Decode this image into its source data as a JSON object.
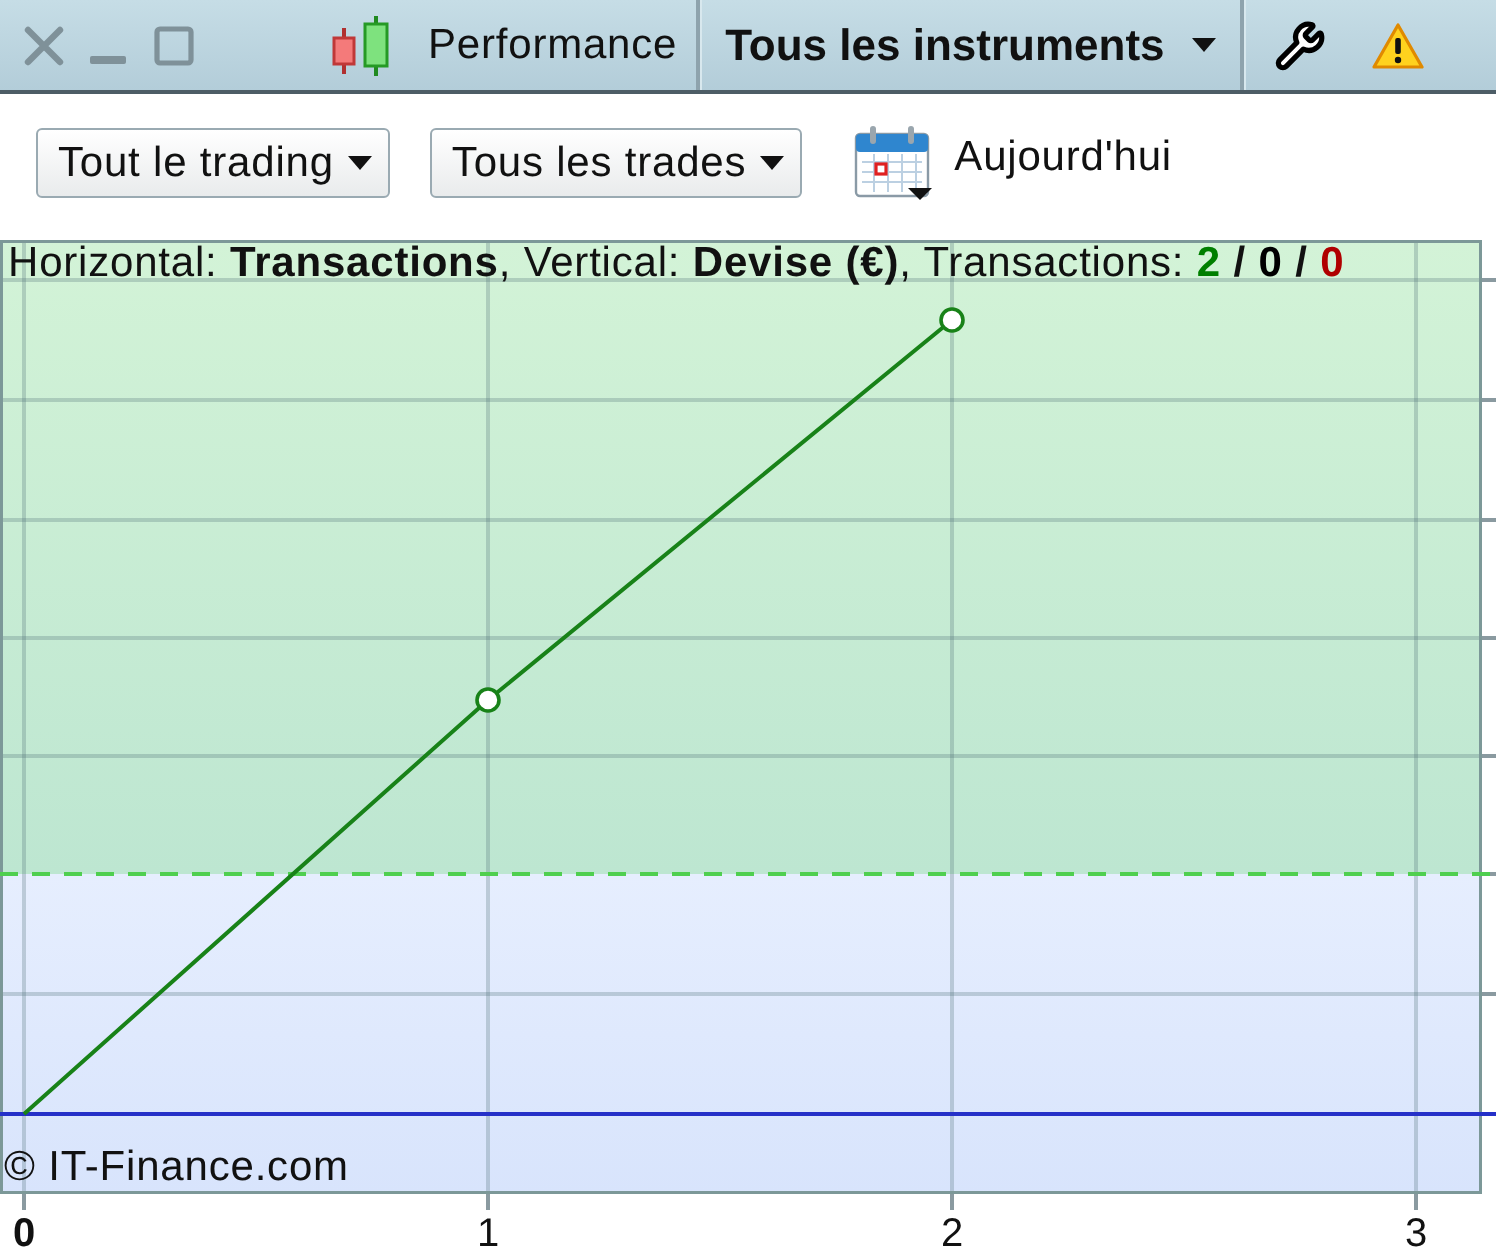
{
  "title_bar": {
    "title": "Performance",
    "instrument_menu": "Tous les instruments"
  },
  "toolbar": {
    "filters": [
      {
        "label": "Tout le trading"
      },
      {
        "label": "Tous les trades"
      }
    ],
    "date_label": "Aujourd'hui"
  },
  "chart": {
    "caption": {
      "text": "Horizontal: **Transactions**, Vertical: **Devise (€)**, Transactions:",
      "counts": [
        {
          "value": "2",
          "color": "#007f00"
        },
        {
          "value": "0",
          "color": "#000000"
        },
        {
          "value": "0",
          "color": "#b00000"
        }
      ],
      "separators": [
        "/",
        "/"
      ]
    },
    "x_ticks": [
      {
        "label": "0",
        "kind": "origin"
      },
      {
        "label": "1",
        "kind": "tick"
      },
      {
        "label": "2",
        "kind": "tick"
      },
      {
        "label": "3",
        "kind": "tick"
      }
    ],
    "credit": "© IT-Finance.com"
  }
}
